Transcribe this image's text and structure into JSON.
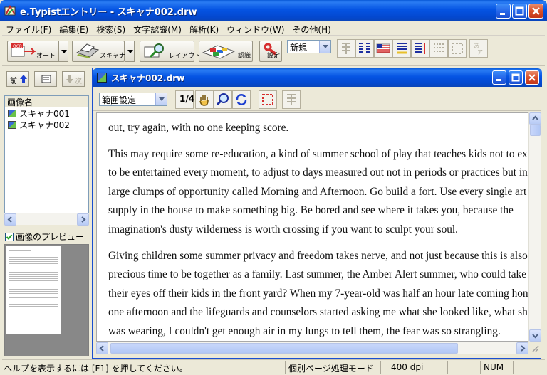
{
  "window": {
    "title": "e.Typistエントリー - スキャナ002.drw"
  },
  "menu": [
    "ファイル(F)",
    "編集(E)",
    "検索(S)",
    "文字認識(M)",
    "解析(K)",
    "ウィンドウ(W)",
    "その他(H)"
  ],
  "toolbar": {
    "auto_label": "オート",
    "scanner_label": "スキャナ",
    "layout_label": "レイアウト",
    "recognize_label": "認識",
    "settings_label": "設定",
    "mode_select_value": "新規"
  },
  "left_panel": {
    "prev_label": "前",
    "next_label": "次",
    "list_header": "画像名",
    "images": [
      "スキャナ001",
      "スキャナ002"
    ],
    "preview_label": "画像のプレビュー",
    "preview_checked": true
  },
  "child_window": {
    "title": "スキャナ002.drw",
    "range_select_value": "範囲設定",
    "scale_label": "1/4"
  },
  "document": {
    "lines": [
      "out, try again, with no one keeping score.",
      "",
      "This may require some re-education, a kind of summer school of play that teaches kids not to expect",
      "to be entertained every moment, to adjust to days measured out not in periods or practices but in",
      "large clumps of opportunity called Morning and Afternoon. Go build a fort. Use every single art",
      "supply in the house to make something big. Be bored and see where it takes you, because the",
      "imagination's dusty wilderness is worth crossing if you want to sculpt your soul.",
      "",
      "Giving children some summer privacy and freedom takes nerve, and not just because this is also",
      "precious time to be together as a family. Last summer, the Amber Alert summer, who could take",
      "their eyes off their kids in the front yard? When my 7-year-old was half an hour late coming home",
      "one afternoon and the lifeguards and counselors started asking me what she looked like, what she",
      "was wearing, I couldn't get enough air in my lungs to tell them, the fear was so strangling."
    ]
  },
  "status": {
    "help": "ヘルプを表示するには [F1] を押してください。",
    "mode": "個別ページ処理モード",
    "dpi": "400 dpi",
    "num": "NUM"
  },
  "colors": {
    "titlebar": "#0554e3",
    "close": "#d8502a",
    "face": "#ece9d8"
  }
}
